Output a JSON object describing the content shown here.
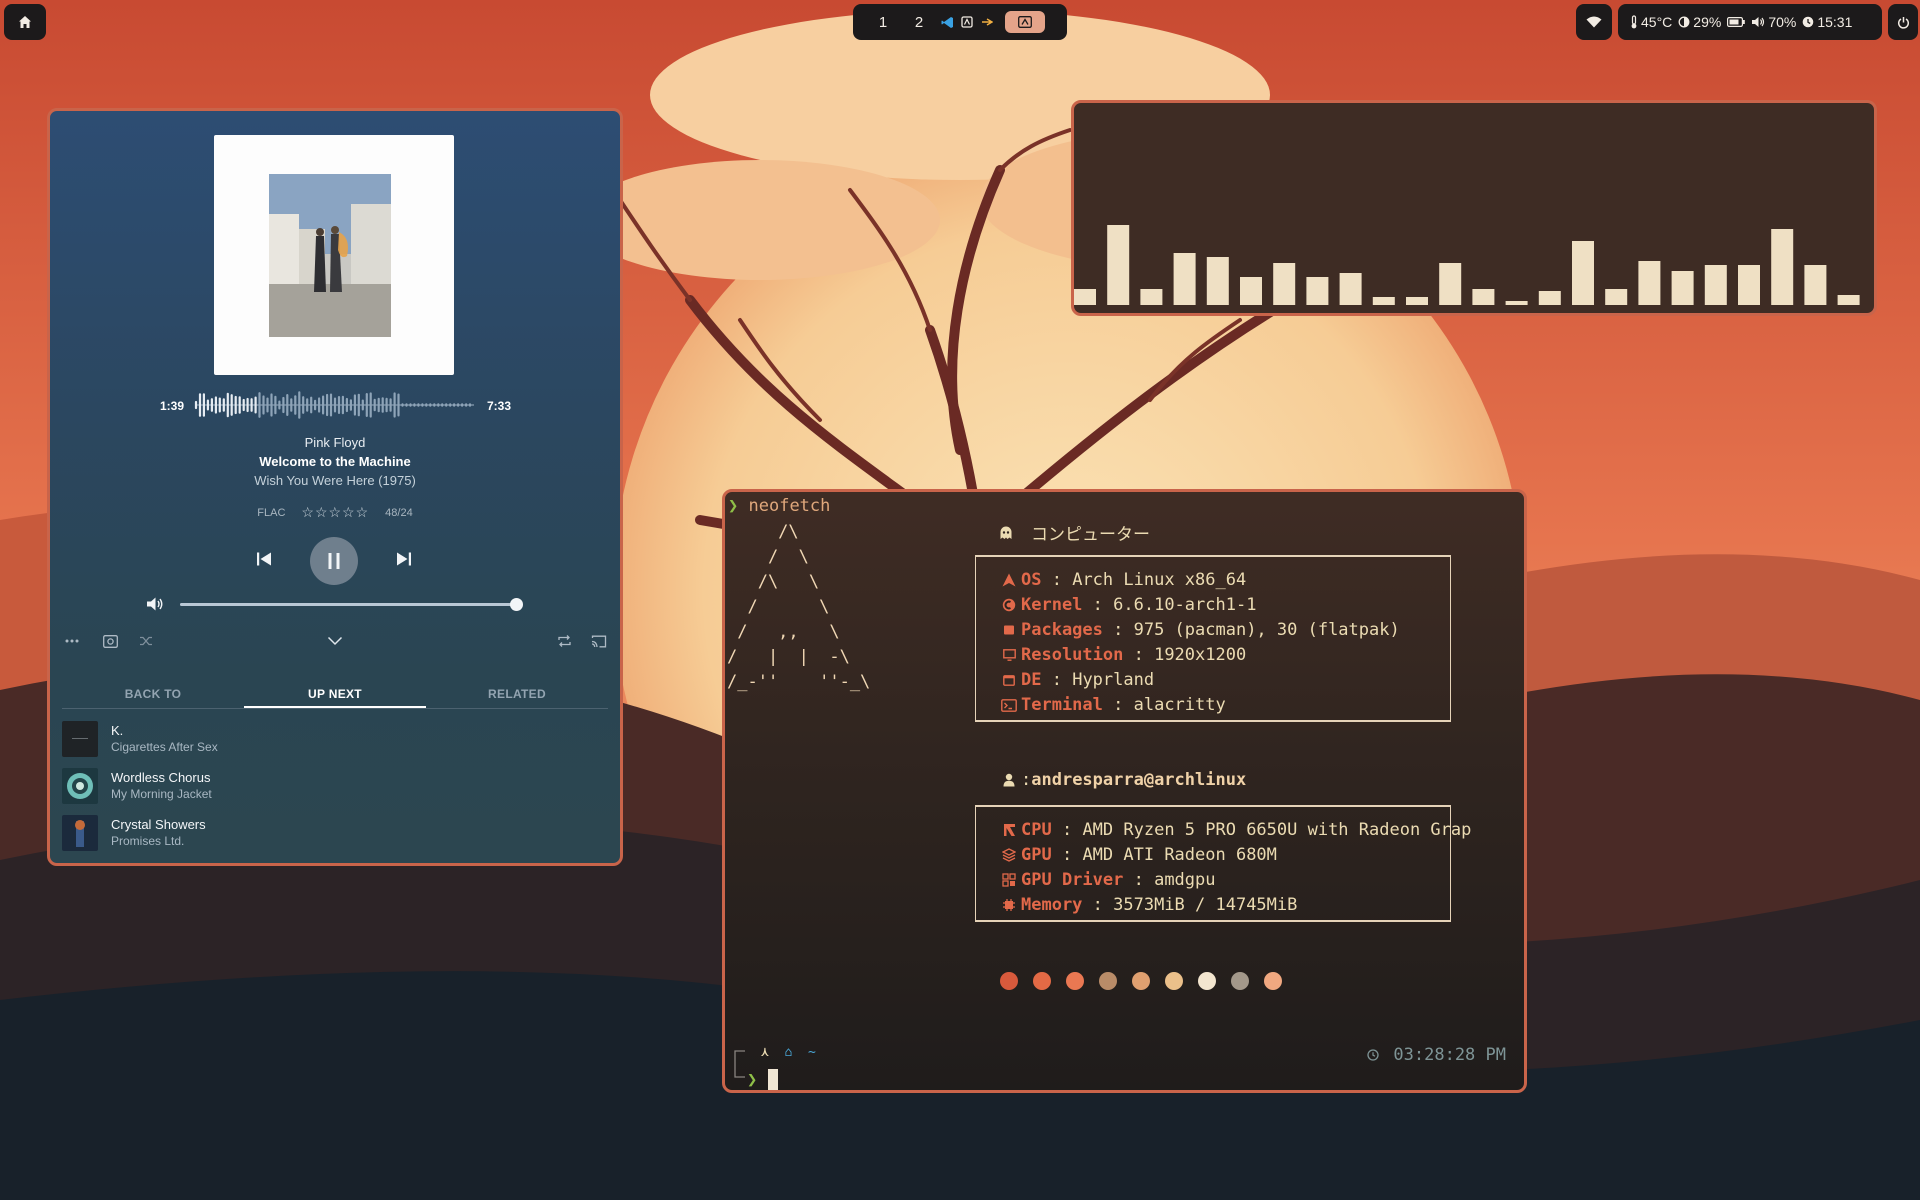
{
  "topbar": {
    "workspaces": [
      "1",
      "2"
    ],
    "workspace_apps": [
      "vscode-icon",
      "app-icon",
      "spark-icon",
      "terminal-icon"
    ],
    "status": {
      "temperature": "45°C",
      "brightness": "29%",
      "volume": "70%",
      "clock": "15:31"
    }
  },
  "player": {
    "time_current": "1:39",
    "time_total": "7:33",
    "progress": 0.22,
    "artist": "Pink Floyd",
    "track": "Welcome to the Machine",
    "album": "Wish You Were Here (1975)",
    "format": "FLAC",
    "rating_stars": "☆☆☆☆☆",
    "bitrate": "48/24",
    "volume_level": 1.0,
    "tabs": [
      {
        "label": "BACK TO",
        "active": false
      },
      {
        "label": "UP NEXT",
        "active": true
      },
      {
        "label": "RELATED",
        "active": false
      }
    ],
    "queue": [
      {
        "title": "K.",
        "artist": "Cigarettes After Sex"
      },
      {
        "title": "Wordless Chorus",
        "artist": "My Morning Jacket"
      },
      {
        "title": "Crystal Showers",
        "artist": "Promises Ltd."
      }
    ]
  },
  "visualizer": {
    "levels": [
      0.08,
      0.4,
      0.08,
      0.26,
      0.24,
      0.14,
      0.21,
      0.14,
      0.16,
      0.04,
      0.04,
      0.21,
      0.08,
      0.02,
      0.07,
      0.32,
      0.08,
      0.22,
      0.17,
      0.2,
      0.2,
      0.38,
      0.2,
      0.05
    ],
    "bar_color": "#efe0c4"
  },
  "terminal": {
    "command": "neofetch",
    "ascii_logo": "     /\\\n    /  \\\n   /\\   \\\n  /      \\\n /   ,,   \\\n/   |  |  -\\\n/_-''    ''-_\\",
    "host_title": "コンピューター",
    "system": [
      {
        "icon": "arch-icon",
        "key": "OS",
        "value": "Arch Linux x86_64"
      },
      {
        "icon": "kernel-icon",
        "key": "Kernel",
        "value": "6.6.10-arch1-1"
      },
      {
        "icon": "package-icon",
        "key": "Packages",
        "value": "975 (pacman), 30 (flatpak)"
      },
      {
        "icon": "monitor-icon",
        "key": "Resolution",
        "value": "1920x1200"
      },
      {
        "icon": "desktop-icon",
        "key": "DE",
        "value": "Hyprland"
      },
      {
        "icon": "terminal-icon",
        "key": "Terminal",
        "value": "alacritty"
      }
    ],
    "user": "andresparra@archlinux",
    "hardware": [
      {
        "icon": "cpu-icon",
        "key": "CPU",
        "value": "AMD Ryzen 5 PRO 6650U with Radeon Grap"
      },
      {
        "icon": "gpu-icon",
        "key": "GPU",
        "value": "AMD ATI Radeon 680M"
      },
      {
        "icon": "chip-icon",
        "key": "GPU Driver",
        "value": "amdgpu"
      },
      {
        "icon": "memory-icon",
        "key": "Memory",
        "value": "3573MiB / 14745MiB"
      }
    ],
    "palette": [
      "#d85a3c",
      "#e36a45",
      "#ea7852",
      "#b98c68",
      "#e0a070",
      "#ebc08a",
      "#f3e6cf",
      "#a3988a",
      "#f0a880"
    ],
    "prompt_path": "~",
    "clock": "03:28:28 PM"
  },
  "colors": {
    "accent": "#c9644a",
    "terminal_key": "#e2694a",
    "prompt_green": "#8fbf48"
  }
}
